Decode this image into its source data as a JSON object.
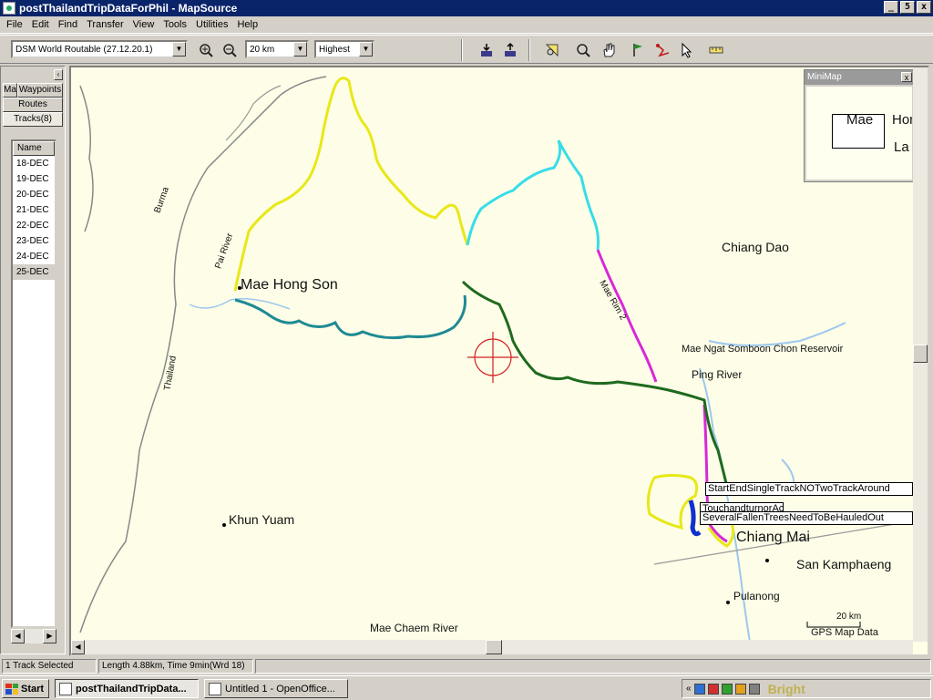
{
  "window": {
    "title": "postThailandTripDataForPhil - MapSource",
    "controls": [
      "_",
      "5",
      "x"
    ]
  },
  "menu": [
    "File",
    "Edit",
    "Find",
    "Transfer",
    "View",
    "Tools",
    "Utilities",
    "Help"
  ],
  "toolbar": {
    "map_product": "DSM World Routable (27.12.20.1)",
    "zoom_scale": "20 km",
    "detail_level": "Highest"
  },
  "left_panel": {
    "tabs": [
      "Maps",
      "Waypoints",
      "Routes",
      "Tracks(8)"
    ],
    "active_tab": "Tracks(8)",
    "column_header": "Name",
    "tracks": [
      "18-DEC",
      "19-DEC",
      "20-DEC",
      "21-DEC",
      "22-DEC",
      "23-DEC",
      "24-DEC",
      "25-DEC"
    ],
    "selected_track": "25-DEC"
  },
  "map": {
    "labels": {
      "mae_hong_son": "Mae Hong Son",
      "chiang_dao": "Chiang Dao",
      "khun_yuam": "Khun Yuam",
      "chiang_mai": "Chiang Mai",
      "san_kamphaeng": "San Kamphaeng",
      "pulanong": "Pulanong",
      "mae_ngat": "Mae Ngat Somboon Chon Reservoir",
      "ping_river": "Ping River",
      "mae_chaem_river": "Mae Chaem River",
      "pai_river": "Pai River",
      "thailand": "Thailand",
      "burma": "Burma",
      "road_label": "Mae Rim 2",
      "scale": "20 km",
      "copyright": "GPS Map Data"
    },
    "popups": [
      "StartEndSingleTrackNOTwoTrackAround",
      "TouchandturnorAcrossRiver",
      "SeveralFallenTreesNeedToBeHauledOut"
    ],
    "track_colors": {
      "yellow": "#e8e818",
      "cyan": "#38dde8",
      "magenta": "#d828d8",
      "dkgreen": "#1e6a1e",
      "teal": "#1f8a94",
      "blue": "#1030d0",
      "water": "#9cc8ee",
      "border": "#888888"
    }
  },
  "minimap": {
    "title": "MiniMap",
    "labels": [
      "Mae",
      "Hon",
      "La"
    ]
  },
  "status": {
    "selection": "1 Track Selected",
    "length": "Length 4.88km, Time 9min(Wrd 18)"
  },
  "taskbar": {
    "start": "Start",
    "tasks": [
      "postThailandTripData...",
      "Untitled 1 - OpenOffice..."
    ],
    "tray_text": "Bright"
  }
}
